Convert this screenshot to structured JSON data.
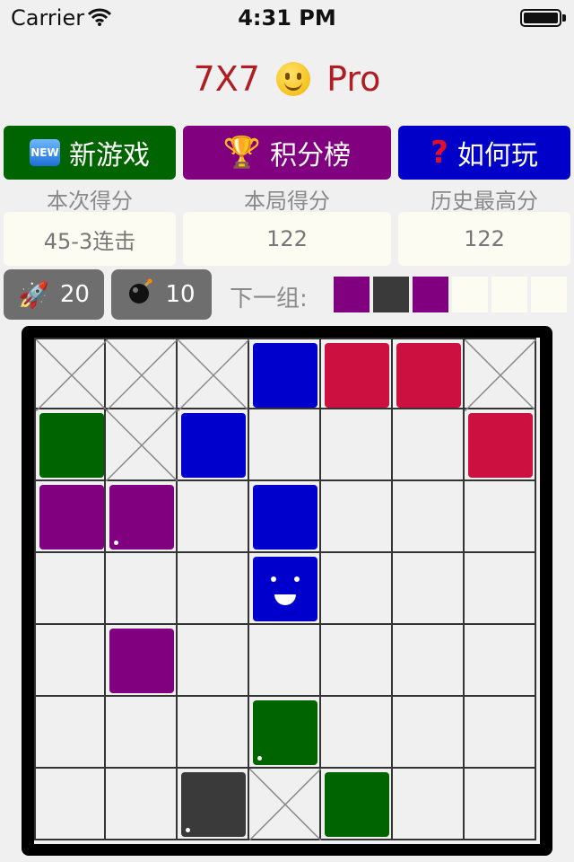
{
  "status_bar": {
    "carrier": "Carrier",
    "time": "4:31 PM"
  },
  "title": {
    "left": "7X7",
    "right": "Pro"
  },
  "menu": {
    "new_game": "新游戏",
    "leaderboard": "积分榜",
    "how_to_play": "如何玩"
  },
  "scores": {
    "labels": [
      "本次得分",
      "本局得分",
      "历史最高分"
    ],
    "values": [
      "45-3连击",
      "122",
      "122"
    ]
  },
  "tools": {
    "rocket_count": "20",
    "bomb_count": "10"
  },
  "next_label": "下一组:",
  "colors": {
    "purple": "#800080",
    "black": "#3a3a3a",
    "blue": "#0000cc",
    "red": "#cc1040",
    "green": "#006400",
    "empty": "#fcfcf2"
  },
  "next_group": [
    "purple",
    "black",
    "purple",
    "empty",
    "empty",
    "empty"
  ],
  "board": [
    [
      "x",
      "x",
      "x",
      "blue",
      "red",
      "red",
      "x"
    ],
    [
      "green",
      "x",
      "blue",
      "",
      "",
      "",
      "red"
    ],
    [
      "purple",
      "purple*",
      "",
      "blue",
      "",
      "",
      ""
    ],
    [
      "",
      "",
      "",
      "blue@",
      "",
      "",
      ""
    ],
    [
      "",
      "purple",
      "",
      "",
      "",
      "",
      ""
    ],
    [
      "",
      "",
      "",
      "green*",
      "",
      "",
      ""
    ],
    [
      "",
      "",
      "black*",
      "x",
      "green",
      "",
      ""
    ]
  ]
}
